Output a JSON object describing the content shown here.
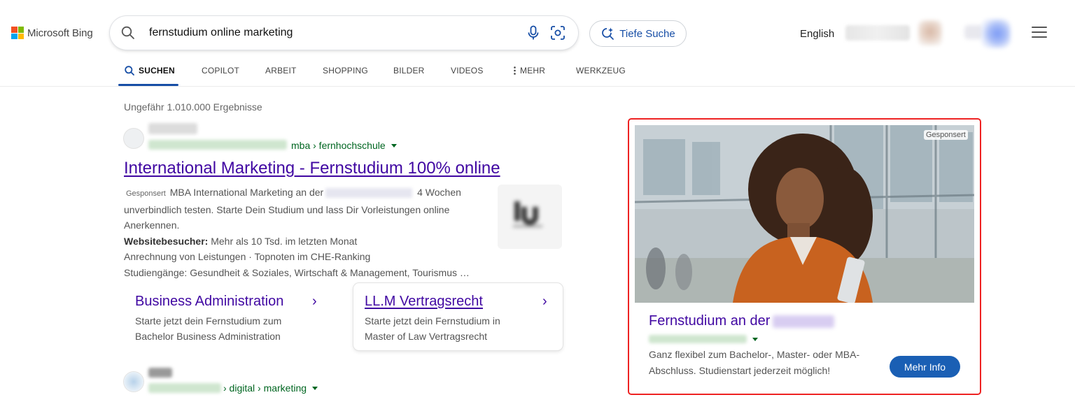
{
  "brand": {
    "logo_text": "Microsoft Bing",
    "logo_colors": [
      "#f25022",
      "#7fba00",
      "#00a4ef",
      "#ffb900"
    ]
  },
  "search": {
    "query": "fernstudium online marketing"
  },
  "deep_search": {
    "label": "Tiefe Suche"
  },
  "header": {
    "language": "English"
  },
  "tabs": [
    {
      "label": "SUCHEN",
      "active": true
    },
    {
      "label": "COPILOT"
    },
    {
      "label": "ARBEIT"
    },
    {
      "label": "SHOPPING"
    },
    {
      "label": "BILDER"
    },
    {
      "label": "VIDEOS"
    },
    {
      "label": "MEHR"
    },
    {
      "label": "WERKZEUG"
    }
  ],
  "results": {
    "count": "Ungefähr 1.010.000 Ergebnisse",
    "r1": {
      "breadcrumb": "mba › fernhochschule",
      "title": "International Marketing - Fernstudium 100% online",
      "sponsored": "Gesponsert",
      "desc_a": "MBA International Marketing an der",
      "desc_b": "4 Wochen unverbindlich testen. Starte Dein Studium und lass Dir Vorleistungen online Anerkennen.",
      "visitors_label": "Websitebesucher:",
      "visitors_text": "Mehr als 10 Tsd. im letzten Monat",
      "line2": "Anrechnung von Leistungen · Topnoten im CHE-Ranking",
      "line3": "Studiengänge: Gesundheit & Soziales, Wirtschaft & Management, Tourismus …",
      "sitelinks": [
        {
          "title": "Business Administration",
          "desc": "Starte jetzt dein Fernstudium zum Bachelor Business Administration"
        },
        {
          "title": "LL.M Vertragsrecht",
          "desc": "Starte jetzt dein Fernstudium in Master of Law Vertragsrecht"
        }
      ]
    },
    "r2": {
      "breadcrumb": "› digital › marketing"
    }
  },
  "ad": {
    "sponsored": "Gesponsert",
    "title": "Fernstudium an der",
    "desc": "Ganz flexibel zum Bachelor-, Master- oder MBA-Abschluss. Studienstart jederzeit möglich!",
    "button": "Mehr Info"
  },
  "colors": {
    "link_purple": "#4007a2",
    "url_green": "#006621",
    "accent_blue": "#174ea6",
    "ad_border": "#e22222"
  }
}
